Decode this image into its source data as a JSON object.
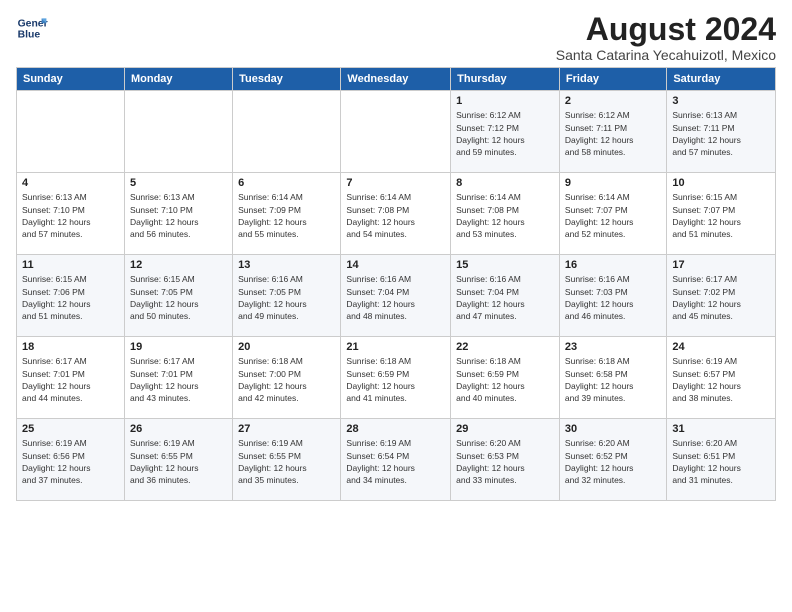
{
  "logo": {
    "line1": "General",
    "line2": "Blue"
  },
  "title": {
    "month_year": "August 2024",
    "location": "Santa Catarina Yecahuizotl, Mexico"
  },
  "headers": [
    "Sunday",
    "Monday",
    "Tuesday",
    "Wednesday",
    "Thursday",
    "Friday",
    "Saturday"
  ],
  "weeks": [
    [
      {
        "day": "",
        "info": ""
      },
      {
        "day": "",
        "info": ""
      },
      {
        "day": "",
        "info": ""
      },
      {
        "day": "",
        "info": ""
      },
      {
        "day": "1",
        "info": "Sunrise: 6:12 AM\nSunset: 7:12 PM\nDaylight: 12 hours\nand 59 minutes."
      },
      {
        "day": "2",
        "info": "Sunrise: 6:12 AM\nSunset: 7:11 PM\nDaylight: 12 hours\nand 58 minutes."
      },
      {
        "day": "3",
        "info": "Sunrise: 6:13 AM\nSunset: 7:11 PM\nDaylight: 12 hours\nand 57 minutes."
      }
    ],
    [
      {
        "day": "4",
        "info": "Sunrise: 6:13 AM\nSunset: 7:10 PM\nDaylight: 12 hours\nand 57 minutes."
      },
      {
        "day": "5",
        "info": "Sunrise: 6:13 AM\nSunset: 7:10 PM\nDaylight: 12 hours\nand 56 minutes."
      },
      {
        "day": "6",
        "info": "Sunrise: 6:14 AM\nSunset: 7:09 PM\nDaylight: 12 hours\nand 55 minutes."
      },
      {
        "day": "7",
        "info": "Sunrise: 6:14 AM\nSunset: 7:08 PM\nDaylight: 12 hours\nand 54 minutes."
      },
      {
        "day": "8",
        "info": "Sunrise: 6:14 AM\nSunset: 7:08 PM\nDaylight: 12 hours\nand 53 minutes."
      },
      {
        "day": "9",
        "info": "Sunrise: 6:14 AM\nSunset: 7:07 PM\nDaylight: 12 hours\nand 52 minutes."
      },
      {
        "day": "10",
        "info": "Sunrise: 6:15 AM\nSunset: 7:07 PM\nDaylight: 12 hours\nand 51 minutes."
      }
    ],
    [
      {
        "day": "11",
        "info": "Sunrise: 6:15 AM\nSunset: 7:06 PM\nDaylight: 12 hours\nand 51 minutes."
      },
      {
        "day": "12",
        "info": "Sunrise: 6:15 AM\nSunset: 7:05 PM\nDaylight: 12 hours\nand 50 minutes."
      },
      {
        "day": "13",
        "info": "Sunrise: 6:16 AM\nSunset: 7:05 PM\nDaylight: 12 hours\nand 49 minutes."
      },
      {
        "day": "14",
        "info": "Sunrise: 6:16 AM\nSunset: 7:04 PM\nDaylight: 12 hours\nand 48 minutes."
      },
      {
        "day": "15",
        "info": "Sunrise: 6:16 AM\nSunset: 7:04 PM\nDaylight: 12 hours\nand 47 minutes."
      },
      {
        "day": "16",
        "info": "Sunrise: 6:16 AM\nSunset: 7:03 PM\nDaylight: 12 hours\nand 46 minutes."
      },
      {
        "day": "17",
        "info": "Sunrise: 6:17 AM\nSunset: 7:02 PM\nDaylight: 12 hours\nand 45 minutes."
      }
    ],
    [
      {
        "day": "18",
        "info": "Sunrise: 6:17 AM\nSunset: 7:01 PM\nDaylight: 12 hours\nand 44 minutes."
      },
      {
        "day": "19",
        "info": "Sunrise: 6:17 AM\nSunset: 7:01 PM\nDaylight: 12 hours\nand 43 minutes."
      },
      {
        "day": "20",
        "info": "Sunrise: 6:18 AM\nSunset: 7:00 PM\nDaylight: 12 hours\nand 42 minutes."
      },
      {
        "day": "21",
        "info": "Sunrise: 6:18 AM\nSunset: 6:59 PM\nDaylight: 12 hours\nand 41 minutes."
      },
      {
        "day": "22",
        "info": "Sunrise: 6:18 AM\nSunset: 6:59 PM\nDaylight: 12 hours\nand 40 minutes."
      },
      {
        "day": "23",
        "info": "Sunrise: 6:18 AM\nSunset: 6:58 PM\nDaylight: 12 hours\nand 39 minutes."
      },
      {
        "day": "24",
        "info": "Sunrise: 6:19 AM\nSunset: 6:57 PM\nDaylight: 12 hours\nand 38 minutes."
      }
    ],
    [
      {
        "day": "25",
        "info": "Sunrise: 6:19 AM\nSunset: 6:56 PM\nDaylight: 12 hours\nand 37 minutes."
      },
      {
        "day": "26",
        "info": "Sunrise: 6:19 AM\nSunset: 6:55 PM\nDaylight: 12 hours\nand 36 minutes."
      },
      {
        "day": "27",
        "info": "Sunrise: 6:19 AM\nSunset: 6:55 PM\nDaylight: 12 hours\nand 35 minutes."
      },
      {
        "day": "28",
        "info": "Sunrise: 6:19 AM\nSunset: 6:54 PM\nDaylight: 12 hours\nand 34 minutes."
      },
      {
        "day": "29",
        "info": "Sunrise: 6:20 AM\nSunset: 6:53 PM\nDaylight: 12 hours\nand 33 minutes."
      },
      {
        "day": "30",
        "info": "Sunrise: 6:20 AM\nSunset: 6:52 PM\nDaylight: 12 hours\nand 32 minutes."
      },
      {
        "day": "31",
        "info": "Sunrise: 6:20 AM\nSunset: 6:51 PM\nDaylight: 12 hours\nand 31 minutes."
      }
    ]
  ]
}
